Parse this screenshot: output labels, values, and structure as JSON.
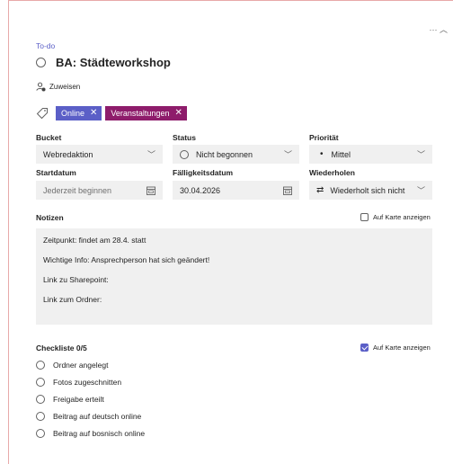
{
  "breadcrumb": "To-do",
  "task": {
    "title": "BA: Städteworkshop"
  },
  "assign_label": "Zuweisen",
  "tags": [
    {
      "label": "Online",
      "color": "#5b5fc7"
    },
    {
      "label": "Veranstaltungen",
      "color": "#8e1c6b"
    }
  ],
  "fields": {
    "bucket": {
      "label": "Bucket",
      "value": "Webredaktion"
    },
    "status": {
      "label": "Status",
      "value": "Nicht begonnen"
    },
    "priority": {
      "label": "Priorität",
      "value": "Mittel"
    },
    "start": {
      "label": "Startdatum",
      "placeholder": "Jederzeit beginnen"
    },
    "due": {
      "label": "Fälligkeitsdatum",
      "value": "30.04.2026"
    },
    "repeat": {
      "label": "Wiederholen",
      "value": "Wiederholt sich nicht"
    }
  },
  "notes": {
    "label": "Notizen",
    "show_on_card": "Auf Karte anzeigen",
    "show_on_card_checked": false,
    "lines": [
      "Zeitpunkt: findet am 28.4. statt",
      "Wichtige Info: Ansprechperson hat sich geändert!",
      "Link zu Sharepoint:",
      "Link zum Ordner:"
    ]
  },
  "checklist": {
    "label": "Checkliste 0/5",
    "show_on_card": "Auf Karte anzeigen",
    "show_on_card_checked": true,
    "items": [
      "Ordner angelegt",
      "Fotos zugeschnitten",
      "Freigabe erteilt",
      "Beitrag auf deutsch online",
      "Beitrag auf bosnisch online"
    ]
  },
  "colors": {
    "accent": "#5b5fc7",
    "field_bg": "#f0f0f0",
    "border": "#e8a9a9"
  }
}
